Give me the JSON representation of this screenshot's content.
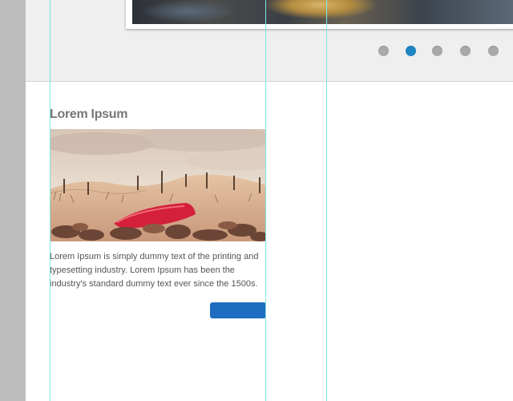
{
  "slider": {
    "slide_count": 5,
    "active_index": 1,
    "active_color": "#1f86c4",
    "inactive_color": "#a9a9a9"
  },
  "card": {
    "title": "Lorem Ipsum",
    "body": "Lorem Ipsum is simply dummy text of the printing and typesetting industry. Lorem Ipsum has been the industry's standard dummy text ever since the 1500s.",
    "button_label": "",
    "button_color": "#1e6cc0"
  }
}
